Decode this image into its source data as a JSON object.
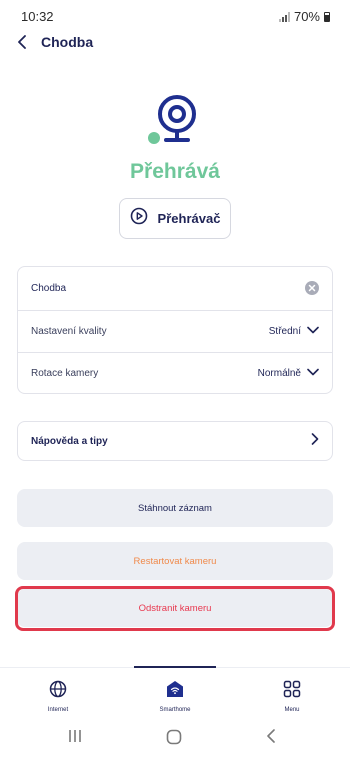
{
  "status_bar": {
    "time": "10:32",
    "battery": "70%"
  },
  "header": {
    "title": "Chodba"
  },
  "camera": {
    "status": "Přehrává",
    "status_color": "#6fc79a",
    "player_button_label": "Přehrávač"
  },
  "settings": {
    "name": "Chodba",
    "quality_label": "Nastavení kvality",
    "quality_value": "Střední",
    "rotation_label": "Rotace kamery",
    "rotation_value": "Normálně"
  },
  "help": {
    "label": "Nápověda a tipy"
  },
  "actions": {
    "download": "Stáhnout záznam",
    "restart": "Restartovat kameru",
    "remove": "Odstranit kameru"
  },
  "colors": {
    "primary": "#1f2456",
    "accent_green": "#6fc79a",
    "warning": "#f08a4b",
    "danger": "#e8384f"
  },
  "bottom_nav": {
    "items": [
      {
        "label": "Internet",
        "icon": "globe-icon"
      },
      {
        "label": "Smarthome",
        "icon": "home-wifi-icon",
        "active": true
      },
      {
        "label": "Menu",
        "icon": "grid-icon"
      }
    ]
  },
  "system_nav": {
    "icons": [
      "recents-icon",
      "home-icon",
      "back-icon"
    ]
  }
}
